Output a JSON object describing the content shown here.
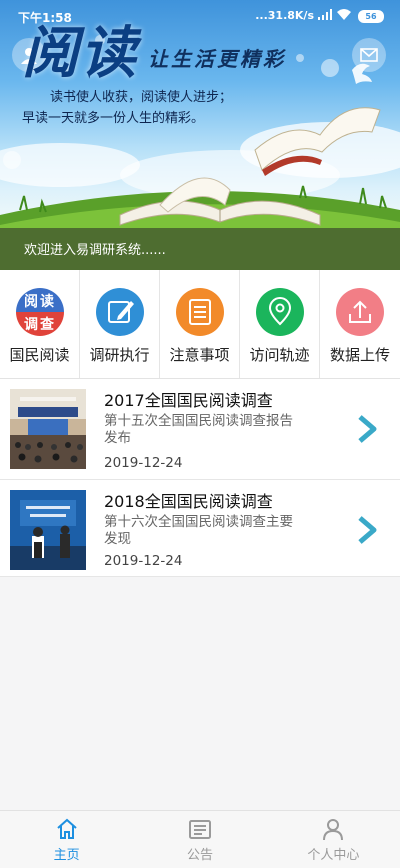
{
  "statusbar": {
    "time": "下午1:58",
    "network_speed": "...31.8K/s",
    "battery": "56"
  },
  "banner": {
    "title": "阅读",
    "subtitle": "让生活更精彩",
    "slogan_line1": "读书使人收获，阅读使人进步；",
    "slogan_line2": "早读一天就多一份人生的精彩。",
    "welcome": "欢迎进入易调研系统......"
  },
  "nav": [
    {
      "label": "国民阅读",
      "icon": "reading-survey-icon",
      "color": "#3b6fc7"
    },
    {
      "label": "调研执行",
      "icon": "edit-icon",
      "color": "#2f8fd6"
    },
    {
      "label": "注意事项",
      "icon": "notes-icon",
      "color": "#f28a2a"
    },
    {
      "label": "访问轨迹",
      "icon": "location-pin-icon",
      "color": "#1bb55c"
    },
    {
      "label": "数据上传",
      "icon": "upload-icon",
      "color": "#f27e86"
    }
  ],
  "news": [
    {
      "title": "2017全国国民阅读调查",
      "desc": "第十五次全国国民阅读调查报告发布",
      "date": "2019-12-24"
    },
    {
      "title": "2018全国国民阅读调查",
      "desc": "第十六次全国国民阅读调查主要发现",
      "date": "2019-12-24"
    }
  ],
  "tabbar": {
    "items": [
      {
        "label": "主页",
        "icon": "home-icon",
        "active": true
      },
      {
        "label": "公告",
        "icon": "notice-icon",
        "active": false
      },
      {
        "label": "个人中心",
        "icon": "person-icon",
        "active": false
      }
    ],
    "active_color": "#1d8fe0",
    "inactive_color": "#9a9a9a"
  },
  "colors": {
    "chevron": "#3aa9c8",
    "page_background": "#f5f5f6"
  }
}
